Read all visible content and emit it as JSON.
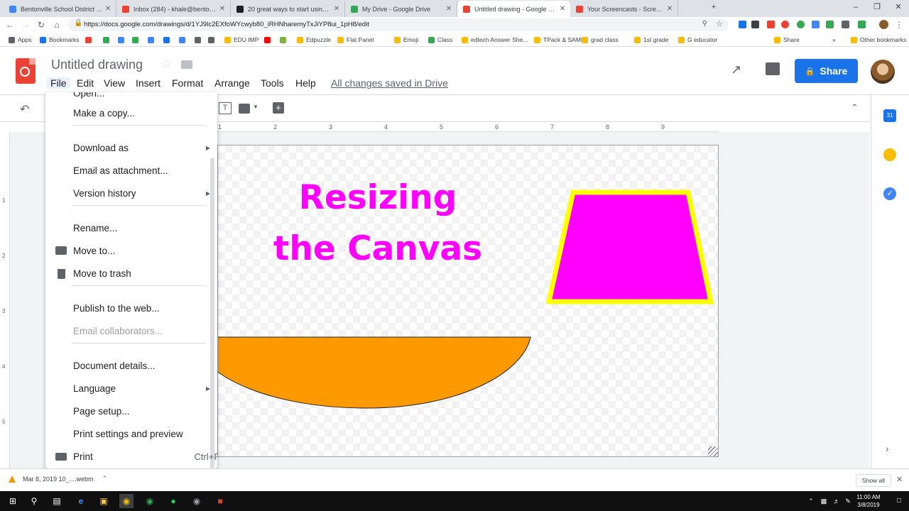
{
  "tabs": [
    {
      "title": "Bentonville School District - Cale",
      "color": "#4285f4"
    },
    {
      "title": "Inbox (284) - khale@bentonvillek",
      "color": "#ea4335"
    },
    {
      "title": "20 great ways to start using Goo",
      "color": "#202124"
    },
    {
      "title": "My Drive - Google Drive",
      "color": "#34a853"
    },
    {
      "title": "Untitled drawing - Google Drawi",
      "color": "#ea4335"
    },
    {
      "title": "Your Screencasts - Screencastify",
      "color": "#ea4335"
    }
  ],
  "browser": {
    "url": "https://docs.google.com/drawings/d/1YJ9lc2EXfoWYcwyb80_iRHNharemyTxJiYP8ui_1pH8/edit",
    "new_tab": "+"
  },
  "bookmarks": [
    {
      "label": "Apps",
      "color": "#5f6368"
    },
    {
      "label": "Bookmarks",
      "color": "#1a73e8"
    },
    {
      "label": "EDU IMP",
      "color": "#fbbc04"
    },
    {
      "label": "Edpuzzle",
      "color": "#fbbc04"
    },
    {
      "label": "Flat Panel",
      "color": "#fbbc04"
    },
    {
      "label": "Emoji",
      "color": "#fbbc04"
    },
    {
      "label": "Class",
      "color": "#34a853"
    },
    {
      "label": "edtech Answer She...",
      "color": "#fbbc04"
    },
    {
      "label": "TPack & SAMR",
      "color": "#fbbc04"
    },
    {
      "label": "grad class",
      "color": "#fbbc04"
    },
    {
      "label": "1st grade",
      "color": "#fbbc04"
    },
    {
      "label": "G educator",
      "color": "#fbbc04"
    },
    {
      "label": "Share",
      "color": "#fbbc04"
    },
    {
      "label": "Other bookmarks",
      "color": "#fbbc04"
    }
  ],
  "bookmarks_more": "»",
  "app": {
    "title": "Untitled drawing",
    "menus": [
      "File",
      "Edit",
      "View",
      "Insert",
      "Format",
      "Arrange",
      "Tools",
      "Help"
    ],
    "saved_status": "All changes saved in Drive",
    "share_label": "Share"
  },
  "file_menu": {
    "items": [
      {
        "label": "Make a copy..."
      },
      {
        "label": "Download as",
        "submenu": true
      },
      {
        "label": "Email as attachment..."
      },
      {
        "label": "Version history",
        "submenu": true
      },
      {
        "label": "Rename..."
      },
      {
        "label": "Move to...",
        "icon": "folder-icon"
      },
      {
        "label": "Move to trash",
        "icon": "trash-icon"
      },
      {
        "label": "Publish to the web..."
      },
      {
        "label": "Email collaborators...",
        "disabled": true
      },
      {
        "label": "Document details..."
      },
      {
        "label": "Language",
        "submenu": true
      },
      {
        "label": "Page setup..."
      },
      {
        "label": "Print settings and preview"
      },
      {
        "label": "Print",
        "icon": "print-icon",
        "shortcut": "Ctrl+P"
      }
    ]
  },
  "ruler": {
    "h_ticks": [
      "1",
      "2",
      "3",
      "4",
      "5",
      "6",
      "7",
      "8",
      "9"
    ],
    "v_ticks": [
      "1",
      "2",
      "3",
      "4",
      "5"
    ]
  },
  "canvas": {
    "title": "Resizing the Canvas",
    "title_color": "#ff00ff",
    "trapezoid_fill": "#ff00ff",
    "trapezoid_border": "#ffff00",
    "half_oval_fill": "#ff9900"
  },
  "downloads": {
    "file": "Mar 8, 2019 10_....webm",
    "show_all": "Show all"
  },
  "taskbar": {
    "time": "11:00 AM",
    "date": "3/8/2019"
  }
}
